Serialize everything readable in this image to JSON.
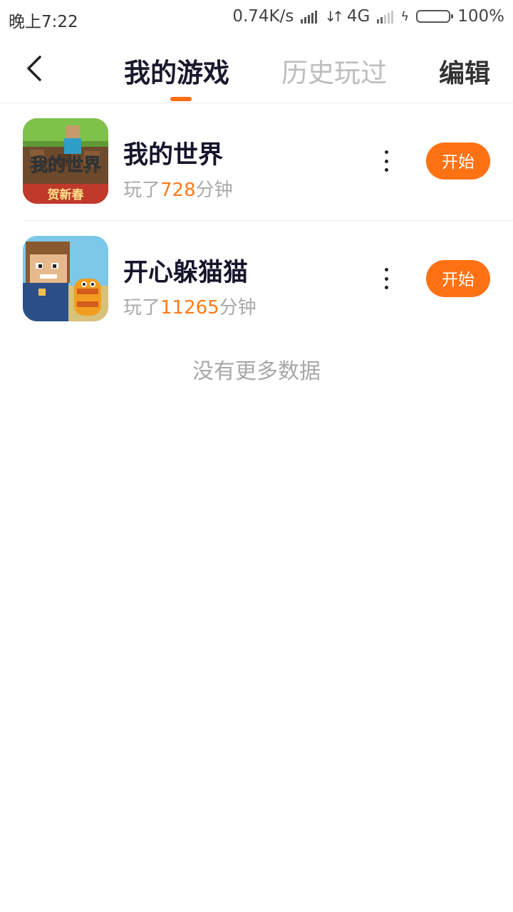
{
  "status_bar": {
    "time": "晚上7:22",
    "network_speed": "0.74K/s",
    "network_type": "4G",
    "battery": "100%",
    "battery_level": 1.0,
    "battery_color": "#35c21b"
  },
  "header": {
    "tabs": [
      {
        "label": "我的游戏",
        "active": true
      },
      {
        "label": "历史玩过",
        "active": false
      }
    ],
    "edit_label": "编辑",
    "accent_color": "#ff6a13"
  },
  "games": [
    {
      "name": "我的世界",
      "played_prefix": "玩了",
      "played_minutes": "728",
      "played_suffix": "分钟",
      "start_label": "开始",
      "icon_text": "我的世界",
      "icon_banner": "贺新春"
    },
    {
      "name": "开心躲猫猫",
      "played_prefix": "玩了",
      "played_minutes": "11265",
      "played_suffix": "分钟",
      "start_label": "开始"
    }
  ],
  "footer_text": "没有更多数据"
}
